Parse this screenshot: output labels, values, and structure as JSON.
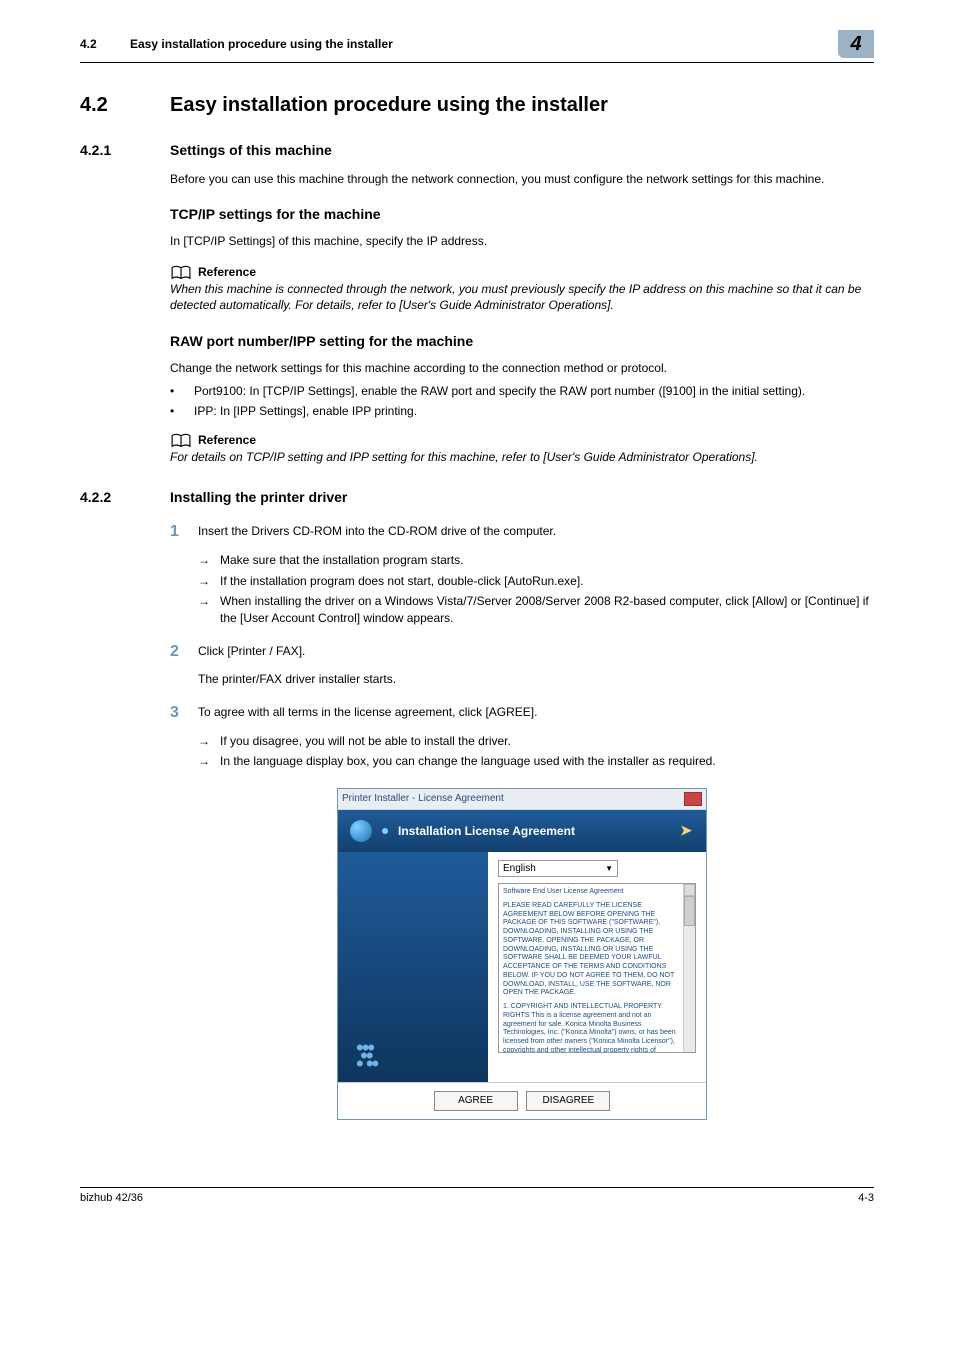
{
  "header": {
    "num": "4.2",
    "title": "Easy installation procedure using the installer",
    "chapter_badge": "4"
  },
  "section": {
    "num": "4.2",
    "title": "Easy installation procedure using the installer"
  },
  "s421": {
    "num": "4.2.1",
    "title": "Settings of this machine",
    "intro": "Before you can use this machine through the network connection, you must configure the network settings for this machine.",
    "tcp": {
      "heading": "TCP/IP settings for the machine",
      "body": "In [TCP/IP Settings] of this machine, specify the IP address.",
      "ref_label": "Reference",
      "ref_body": "When this machine is connected through the network, you must previously specify the IP address on this machine so that it can be detected automatically. For details, refer to [User's Guide Administrator Operations]."
    },
    "raw": {
      "heading": "RAW port number/IPP setting for the machine",
      "lead": "Change the network settings for this machine according to the connection method or protocol.",
      "b1": "Port9100: In [TCP/IP Settings], enable the RAW port and specify the RAW port number ([9100] in the initial setting).",
      "b2": "IPP: In [IPP Settings], enable IPP printing.",
      "ref_label": "Reference",
      "ref_body": "For details on TCP/IP setting and IPP setting for this machine, refer to [User's Guide Administrator Operations]."
    }
  },
  "s422": {
    "num": "4.2.2",
    "title": "Installing the printer driver",
    "step1": {
      "text": "Insert the Drivers CD-ROM into the CD-ROM drive of the computer.",
      "a1": "Make sure that the installation program starts.",
      "a2": "If the installation program does not start, double-click [AutoRun.exe].",
      "a3": "When installing the driver on a Windows Vista/7/Server 2008/Server 2008 R2-based computer, click [Allow] or [Continue] if the [User Account Control] window appears."
    },
    "step2": {
      "text": "Click [Printer / FAX].",
      "after": "The printer/FAX driver installer starts."
    },
    "step3": {
      "text": "To agree with all terms in the license agreement, click [AGREE].",
      "a1": "If you disagree, you will not be able to install the driver.",
      "a2": "In the language display box, you can change the language used with the installer as required."
    }
  },
  "dialog": {
    "titlebar": "Printer Installer - License Agreement",
    "banner": "Installation License Agreement",
    "language": "English",
    "eula_title": "Software End User License Agreement",
    "eula_p1": "PLEASE READ CAREFULLY THE LICENSE AGREEMENT BELOW BEFORE OPENING THE PACKAGE OF THIS SOFTWARE (\"SOFTWARE\"), DOWNLOADING, INSTALLING OR USING THE SOFTWARE. OPENING THE PACKAGE, OR DOWNLOADING, INSTALLING OR USING THE SOFTWARE SHALL BE DEEMED YOUR LAWFUL ACCEPTANCE OF THE TERMS AND CONDITIONS BELOW. IF YOU DO NOT AGREE TO THEM, DO NOT DOWNLOAD, INSTALL, USE THE SOFTWARE, NOR OPEN THE PACKAGE.",
    "eula_p2": "1. COPYRIGHT AND INTELLECTUAL PROPERTY RIGHTS\nThis is a license agreement and not an agreement for sale. Konica Minolta Business Technologies, Inc. (\"Konica Minolta\") owns, or has been licensed from other owners (\"Konica Minolta Licensor\"), copyrights and other intellectual property rights of",
    "agree": "AGREE",
    "disagree": "DISAGREE"
  },
  "footer": {
    "left": "bizhub 42/36",
    "right": "4-3"
  }
}
